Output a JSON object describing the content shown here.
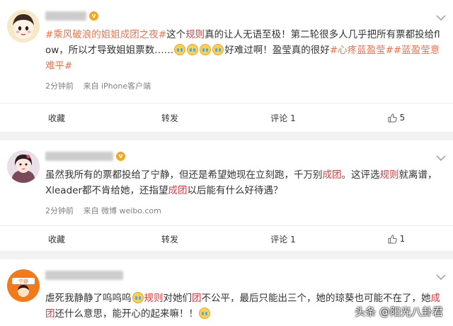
{
  "comments": [
    {
      "username_visible": "",
      "text_segments": [
        {
          "t": "#乘风破浪的姐姐成团之夜#",
          "c": "lnk"
        },
        {
          "t": "这个",
          "c": ""
        },
        {
          "t": "规则",
          "c": "red"
        },
        {
          "t": "真的让人无语至极！第二轮很多人几乎把所有票都投给flow，所以才导致姐姐票数……",
          "c": ""
        },
        {
          "t": "E",
          "c": "em"
        },
        {
          "t": "E",
          "c": "em"
        },
        {
          "t": "E",
          "c": "em"
        },
        {
          "t": "E",
          "c": "em"
        },
        {
          "t": "好难过啊！盈莹真的很好",
          "c": ""
        },
        {
          "t": "#心疼蓝盈莹##蓝盈莹意难平#",
          "c": "lnk"
        }
      ],
      "time": "2分钟前",
      "source": "来自 iPhone客户端",
      "actions": {
        "collect": "收藏",
        "share": "转发",
        "comment": "评论 1",
        "like": "5"
      }
    },
    {
      "username_visible": "",
      "text_segments": [
        {
          "t": "虽然我所有的票都投给了宁静，但还是希望她现在立刻跑，千万别",
          "c": ""
        },
        {
          "t": "成团",
          "c": "red"
        },
        {
          "t": "。这评选",
          "c": ""
        },
        {
          "t": "规则",
          "c": "red"
        },
        {
          "t": "就离谱，Xleader都不肯给她，还指望",
          "c": ""
        },
        {
          "t": "成团",
          "c": "red"
        },
        {
          "t": "以后能有什么好待遇？",
          "c": ""
        }
      ],
      "time": "2分钟前",
      "source": "来自 微博 weibo.com",
      "actions": {
        "collect": "收藏",
        "share": "转发",
        "comment": "评论 1",
        "like": "1"
      }
    },
    {
      "username_visible": "",
      "text_segments": [
        {
          "t": "虐死我静静了呜呜呜",
          "c": ""
        },
        {
          "t": "E",
          "c": "em"
        },
        {
          "t": "规则",
          "c": "red"
        },
        {
          "t": "对她们",
          "c": ""
        },
        {
          "t": "团",
          "c": "red"
        },
        {
          "t": "不公平，最后只能出三个，她的琼葵也可能不在了，她",
          "c": ""
        },
        {
          "t": "成团",
          "c": "red"
        },
        {
          "t": "还什么意思，能开心的起来嘛！！",
          "c": ""
        },
        {
          "t": "E",
          "c": "em"
        }
      ]
    }
  ],
  "watermark": "头条 @阳光八卦君",
  "colors": {
    "link": "#eb7350",
    "keyword": "#e2383b",
    "bg": "#f2f2f2"
  }
}
